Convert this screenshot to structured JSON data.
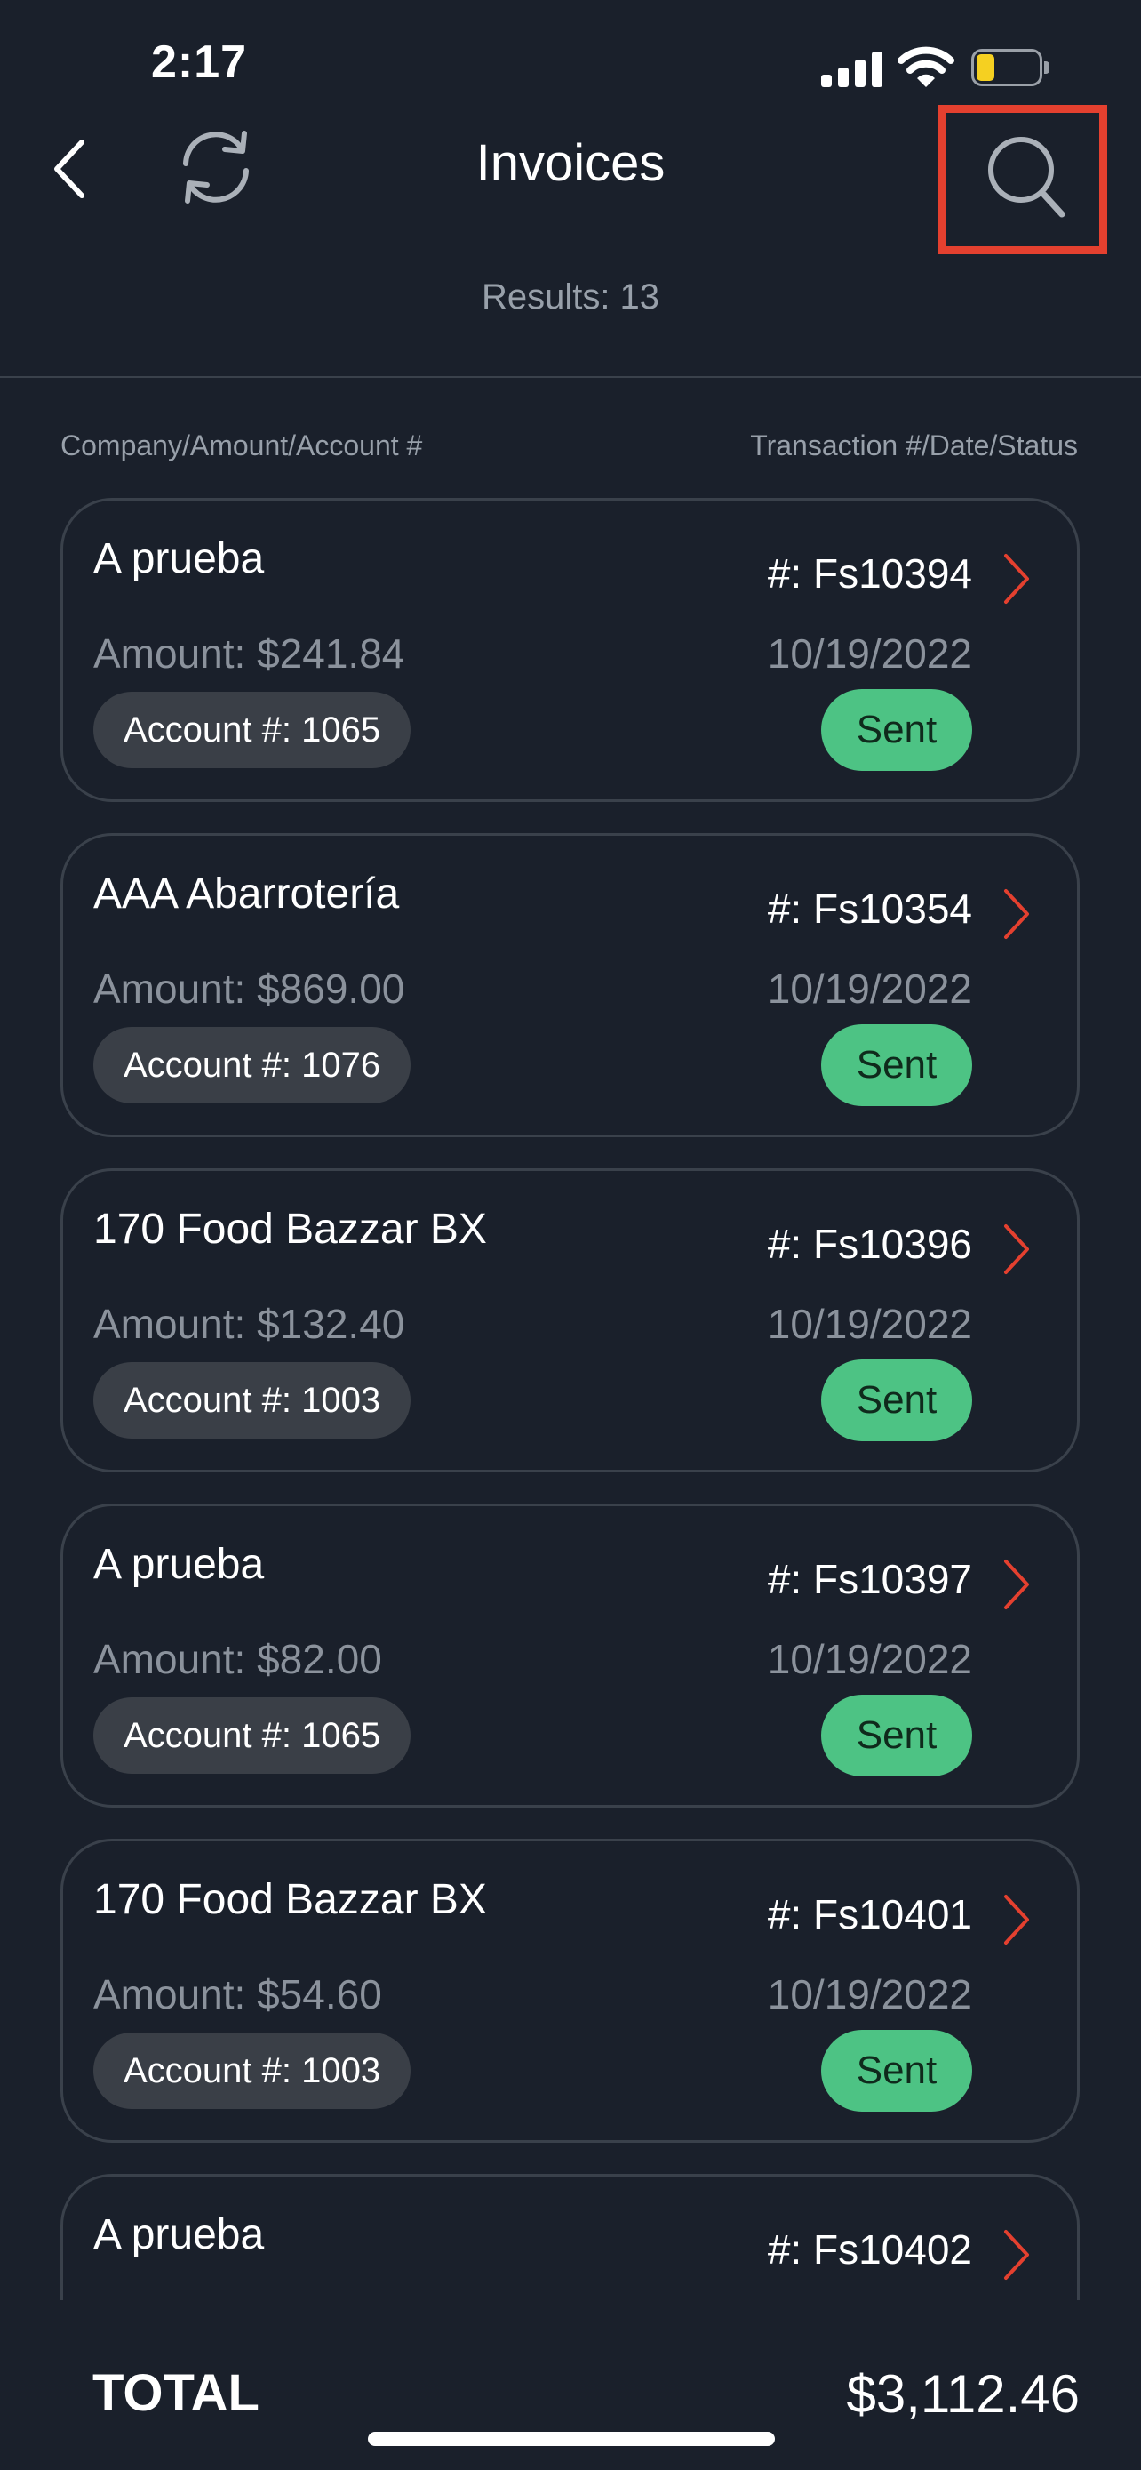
{
  "status_bar": {
    "time": "2:17"
  },
  "nav": {
    "title": "Invoices"
  },
  "results": "Results: 13",
  "columns": {
    "left": "Company/Amount/Account #",
    "right": "Transaction #/Date/Status"
  },
  "invoices": [
    {
      "company": "A prueba",
      "transaction": "#: Fs10394",
      "amount": "Amount: $241.84",
      "date": "10/19/2022",
      "account": "Account #: 1065",
      "status": "Sent"
    },
    {
      "company": "AAA Abarrotería",
      "transaction": "#: Fs10354",
      "amount": "Amount: $869.00",
      "date": "10/19/2022",
      "account": "Account #: 1076",
      "status": "Sent"
    },
    {
      "company": "170 Food Bazzar BX",
      "transaction": "#: Fs10396",
      "amount": "Amount: $132.40",
      "date": "10/19/2022",
      "account": "Account #: 1003",
      "status": "Sent"
    },
    {
      "company": "A prueba",
      "transaction": "#: Fs10397",
      "amount": "Amount: $82.00",
      "date": "10/19/2022",
      "account": "Account #: 1065",
      "status": "Sent"
    },
    {
      "company": "170 Food Bazzar BX",
      "transaction": "#: Fs10401",
      "amount": "Amount: $54.60",
      "date": "10/19/2022",
      "account": "Account #: 1003",
      "status": "Sent"
    },
    {
      "company": "A prueba",
      "transaction": "#: Fs10402",
      "amount": "",
      "date": "",
      "account": "",
      "status": ""
    }
  ],
  "footer": {
    "total_label": "TOTAL",
    "total_value": "$3,112.46"
  },
  "colors": {
    "status_sent": "#4dc384",
    "chevron": "#e4402f",
    "highlight": "#e4402f",
    "background": "#1a202b"
  }
}
